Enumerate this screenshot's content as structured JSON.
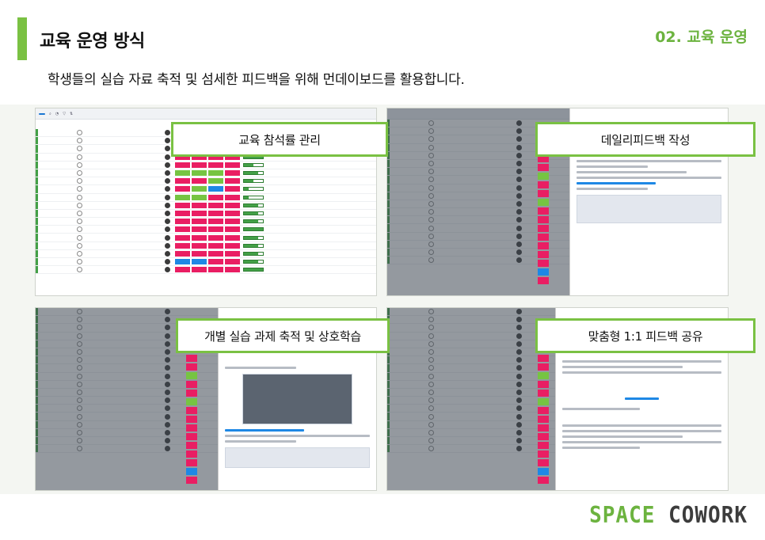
{
  "header": {
    "title": "교육 운영 방식",
    "section_tag": "02. 교육 운영",
    "subtitle": "학생들의 실습 자료 축적 및 섬세한 피드백을 위해 먼데이보드를 활용합니다."
  },
  "callouts": [
    {
      "label": "교육 참석률 관리"
    },
    {
      "label": "데일리피드백 작성"
    },
    {
      "label": "개별 실습 과제 축적 및 상호학습"
    },
    {
      "label": "맞춤형 1:1 피드백 공유"
    }
  ],
  "brand": {
    "part1": "SPACE ",
    "part2": "COWORK"
  },
  "colors": {
    "accent": "#7ac143",
    "brand_green": "#6cb33f",
    "done": "#43a047",
    "absent": "#e91e63",
    "late": "#76c442",
    "excused": "#1e88e5"
  }
}
